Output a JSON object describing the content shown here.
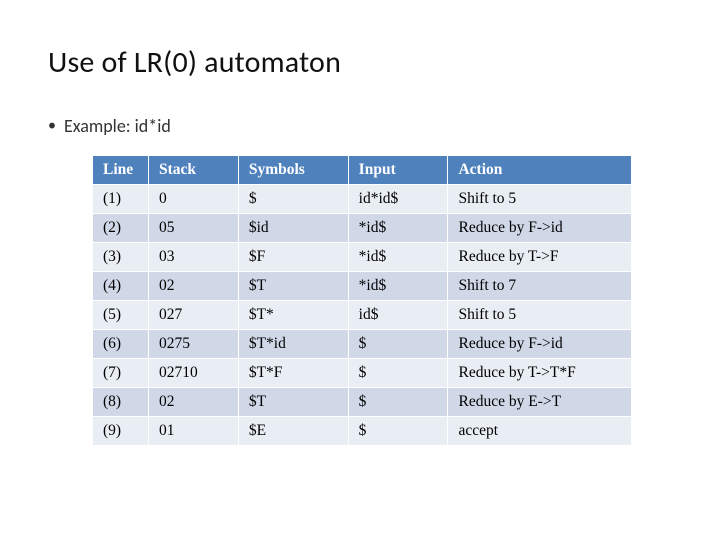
{
  "title": "Use of LR(0) automaton",
  "bullet": "Example: id*id",
  "chart_data": {
    "type": "table",
    "headers": [
      "Line",
      "Stack",
      "Symbols",
      "Input",
      "Action"
    ],
    "rows": [
      {
        "line": "(1)",
        "stack": "0",
        "symbols": "$",
        "input": "id*id$",
        "action": "Shift to 5"
      },
      {
        "line": "(2)",
        "stack": "05",
        "symbols": "$id",
        "input": "*id$",
        "action": "Reduce by F->id"
      },
      {
        "line": "(3)",
        "stack": "03",
        "symbols": "$F",
        "input": "*id$",
        "action": "Reduce by T->F"
      },
      {
        "line": "(4)",
        "stack": "02",
        "symbols": "$T",
        "input": "*id$",
        "action": "Shift to 7"
      },
      {
        "line": "(5)",
        "stack": "027",
        "symbols": "$T*",
        "input": "id$",
        "action": "Shift to 5"
      },
      {
        "line": "(6)",
        "stack": "0275",
        "symbols": "$T*id",
        "input": "$",
        "action": "Reduce by F->id"
      },
      {
        "line": "(7)",
        "stack": "02710",
        "symbols": "$T*F",
        "input": "$",
        "action": "Reduce by T->T*F"
      },
      {
        "line": "(8)",
        "stack": "02",
        "symbols": "$T",
        "input": "$",
        "action": "Reduce by E->T"
      },
      {
        "line": "(9)",
        "stack": "01",
        "symbols": "$E",
        "input": "$",
        "action": "accept"
      }
    ]
  }
}
